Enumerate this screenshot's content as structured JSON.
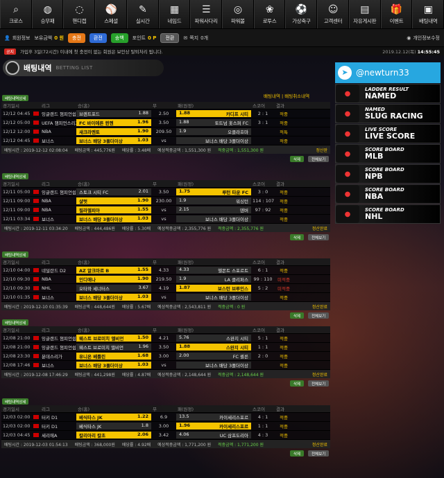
{
  "nav": [
    "크로스",
    "승무패",
    "핸디캡",
    "스페셜",
    "실시간",
    "네임드",
    "파워사다리",
    "파워볼",
    "로투스",
    "가상축구",
    "고객센터",
    "자유게시판",
    "이벤트",
    "배팅내역"
  ],
  "status": {
    "member": "회원정보",
    "money_label": "보유금액",
    "money": "0 원",
    "charge": "충전",
    "exchange": "환전",
    "point": "송백",
    "point_label": "포인트",
    "point_val": "0 P",
    "convert": "전환",
    "note_label": "쪽지",
    "note_val": "0개",
    "account": "개인정보수정"
  },
  "notice": {
    "badge": "공지",
    "text": "가입후 3일(72시간) 이내에 첫 충전이 없는 회원은 보안상 탈퇴처리 됩니다.",
    "date": "2019.12.12(목)",
    "time": "14:55:45"
  },
  "title": {
    "main": "배팅내역",
    "sub": "BETTING LIST"
  },
  "links": "배팅내역  |  배팅취소내역",
  "hdr": [
    "경기일시",
    "",
    "리그",
    "승(홈)",
    "무",
    "패(원정)",
    "스코어",
    "결과"
  ],
  "bets": [
    {
      "rows": [
        [
          "12/12 04:45",
          "잉글랜드 챔피언쉽",
          "브렌트포드",
          "1.88",
          "2.50",
          "1.88",
          "카디프 시티",
          "2 : 1",
          "적중",
          "away"
        ],
        [
          "12/12 05:00",
          "UEFA 챔피언스리그",
          "FC 바이에른 뮌헨",
          "1.96",
          "3.50",
          "1.88",
          "토트넘 홋스퍼 FC",
          "3 : 1",
          "적중",
          "home"
        ],
        [
          "12/12 12:00",
          "NBA",
          "새크라멘토",
          "1.90",
          "209.50",
          "1.9",
          "오클라호마",
          "",
          "적특",
          "home"
        ],
        [
          "12/12 04:45",
          "보너스",
          "보너스 배당 3폴더이상",
          "1.03",
          "vs",
          "",
          "보너스 배당 3폴더이상",
          "",
          "적중",
          "home"
        ]
      ],
      "sum": [
        "배팅시간 : 2019-12-12 02:08:04",
        "배팅금액 : 445,776원",
        "배당률 : 3.48배",
        "예상적중금액 : 1,551,300 원",
        "적중금액 : 1,551,300 원",
        "정산완"
      ]
    },
    {
      "rows": [
        [
          "12/11 05:00",
          "잉글랜드 챔피언쉽",
          "스토크 시티 FC",
          "2.01",
          "3.50",
          "1.75",
          "루턴 타운 FC",
          "3 : 0",
          "적중",
          "away"
        ],
        [
          "12/11 09:00",
          "NBA",
          "샬럿",
          "1.90",
          "230.00",
          "1.9",
          "워싱턴",
          "114 : 107",
          "적중",
          "home"
        ],
        [
          "12/11 09:00",
          "NBA",
          "필라델피아",
          "1.55",
          "vs",
          "2.15",
          "덴버",
          "97 : 92",
          "적중",
          "home"
        ],
        [
          "12/11 03:34",
          "보너스",
          "보너스 배당 3폴더이상",
          "1.03",
          "vs",
          "",
          "보너스 배당 3폴더이상",
          "",
          "적중",
          "home"
        ]
      ],
      "sum": [
        "배팅시간 : 2019-12-11 03:34:20",
        "배팅금액 : 444,486원",
        "배당률 : 5.30배",
        "예상적중금액 : 2,355,776 원",
        "적중금액 : 2,355,776 원",
        "정산완료"
      ]
    },
    {
      "rows": [
        [
          "12/10 04:00",
          "네덜란드 D2",
          "AZ 알크마르 B",
          "1.55",
          "4.33",
          "4.33",
          "헬몬트 스포르트",
          "6 : 1",
          "적중",
          "home"
        ],
        [
          "12/10 09:30",
          "NBA",
          "인디애나",
          "1.90",
          "219.50",
          "1.9",
          "LA 클리퍼스",
          "99 : 110",
          "미적중",
          "home"
        ],
        [
          "12/10 09:30",
          "NHL",
          "오타와 세너터스",
          "3.67",
          "4.19",
          "1.87",
          "보스턴 브루인스",
          "5 : 2",
          "미적중",
          "away"
        ],
        [
          "12/10 01:35",
          "보너스",
          "보너스 배당 3폴더이상",
          "1.03",
          "vs",
          "",
          "보너스 배당 3폴더이상",
          "",
          "적중",
          "home"
        ]
      ],
      "sum": [
        "배팅시간 : 2019-12-10 01:35:39",
        "배팅금액 : 448,644원",
        "배당률 : 5.67배",
        "예상적중금액 : 2,543,811 원",
        "적중금액 : 0 원",
        "정산완료"
      ]
    },
    {
      "rows": [
        [
          "12/08 21:00",
          "잉글랜드 챔피언쉽",
          "웨스트 브로미치 앨비언",
          "1.50",
          "4.21",
          "5.76",
          "스완지 시티",
          "5 : 1",
          "적중",
          "home"
        ],
        [
          "12/08 21:00",
          "잉글랜드 챔피언쉽",
          "웨스트 브로미치 앨비언",
          "1.96",
          "3.50",
          "1.88",
          "스완지 시티",
          "1 : 1",
          "적중",
          "away"
        ],
        [
          "12/08 23:30",
          "분데스리가",
          "유니온 베를린",
          "1.68",
          "3.00",
          "2.00",
          "FC 쾰른",
          "2 : 0",
          "적중",
          "home"
        ],
        [
          "12/08 17:46",
          "보너스",
          "보너스 배당 3폴더이상",
          "1.03",
          "vs",
          "",
          "보너스 배당 3폴더이상",
          "",
          "적중",
          "home"
        ]
      ],
      "sum": [
        "배팅시간 : 2019-12-08 17:46:29",
        "배팅금액 : 441,298원",
        "배당률 : 4.87배",
        "예상적중금액 : 2,148,644 원",
        "적중금액 : 2,148,644 원",
        "정산완료"
      ]
    },
    {
      "rows": [
        [
          "12/03 02:00",
          "터키 D1",
          "베식타스 JK",
          "1.22",
          "6.9",
          "13.5",
          "카이세리스포르",
          "4 : 1",
          "적중",
          "home"
        ],
        [
          "12/03 02:00",
          "터키 D1",
          "베식타스 JK",
          "1.8",
          "3.00",
          "1.96",
          "카이세리스포르",
          "1 : 1",
          "적중",
          "away"
        ],
        [
          "12/03 04:45",
          "세리에A",
          "칼리아리 칼초",
          "2.06",
          "3.42",
          "4.06",
          "UC 삼프도리아",
          "4 : 3",
          "적중",
          "home"
        ]
      ],
      "sum": [
        "배팅시간 : 2019-12-03 01:54:13",
        "배팅금액 : 368,000원",
        "배당률 : 4.92배",
        "예상적중금액 : 1,771,200 원",
        "적중금액 : 1,771,200 원",
        "정산완료"
      ]
    }
  ],
  "tag": "배팅내역상세",
  "btn_delete": "삭제",
  "btn_view": "전체보기",
  "tg": "@newturn33",
  "ads": [
    [
      "LADDER RESULT",
      "NAMED"
    ],
    [
      "NAMED",
      "SLUG RACING"
    ],
    [
      "LIVE SCORE",
      "LIVE SCORE"
    ],
    [
      "SCORE BOARD",
      "MLB"
    ],
    [
      "SCORE BOARD",
      "NPB"
    ],
    [
      "SCORE BOARD",
      "NBA"
    ],
    [
      "SCORE BOARD",
      "NHL"
    ]
  ]
}
